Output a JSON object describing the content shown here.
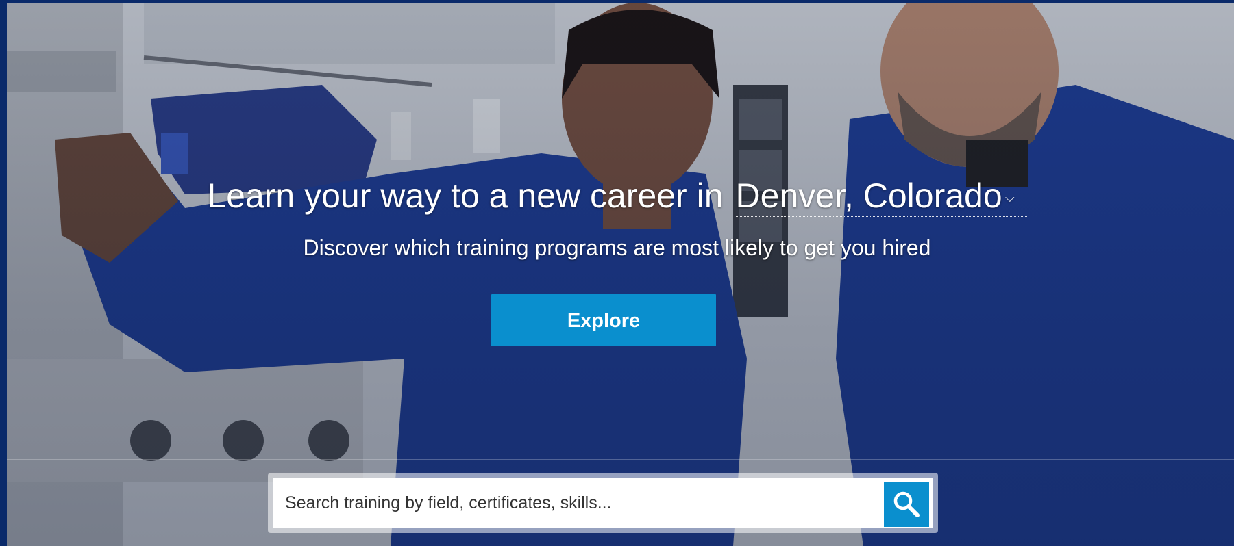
{
  "hero": {
    "headline_lead": "Learn your way to a new career in",
    "location": "Denver, Colorado",
    "subheadline": "Discover which training programs are most likely to get you hired",
    "explore_label": "Explore"
  },
  "search": {
    "placeholder": "Search training by field, certificates, skills..."
  },
  "icons": {
    "search": "search-icon",
    "location_dropdown": "chevron-down-icon"
  },
  "colors": {
    "accent": "#0a8fce",
    "page_edge": "#0a2a6a",
    "coverall_blue": "#1f3f9a"
  }
}
